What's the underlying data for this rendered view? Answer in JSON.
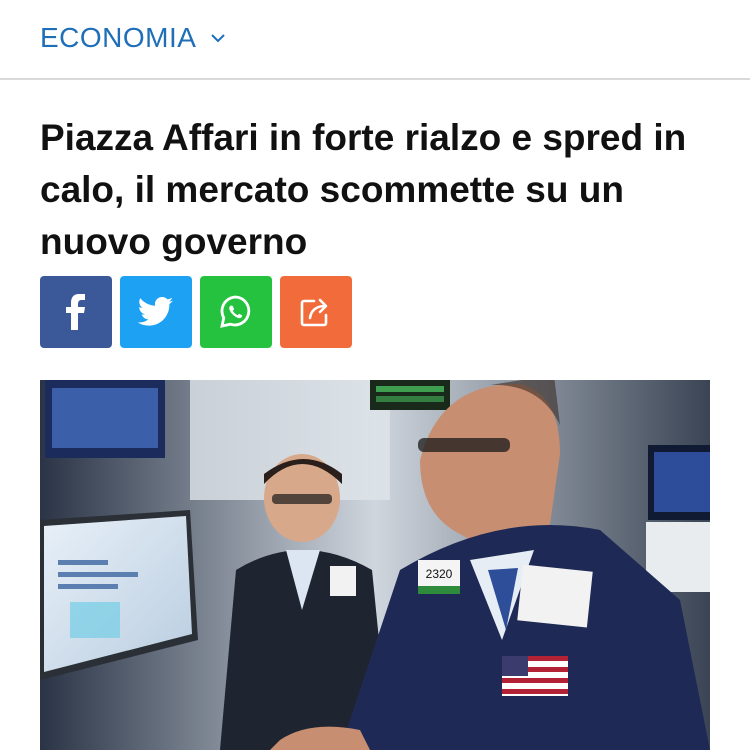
{
  "header": {
    "section_label": "ECONOMIA",
    "chevron_icon": "chevron-down-icon",
    "accent_color": "#1f6fb8"
  },
  "article": {
    "headline": "Piazza Affari in forte rialzo e spred in calo, il mercato scommette su un nuovo governo"
  },
  "share": [
    {
      "name": "facebook",
      "icon": "facebook-icon",
      "color": "#3b5998"
    },
    {
      "name": "twitter",
      "icon": "twitter-icon",
      "color": "#1da1f2"
    },
    {
      "name": "whatsapp",
      "icon": "whatsapp-icon",
      "color": "#25c23f"
    },
    {
      "name": "share",
      "icon": "share-icon",
      "color": "#f26b3a"
    }
  ],
  "photo": {
    "badge_number": "2320"
  }
}
